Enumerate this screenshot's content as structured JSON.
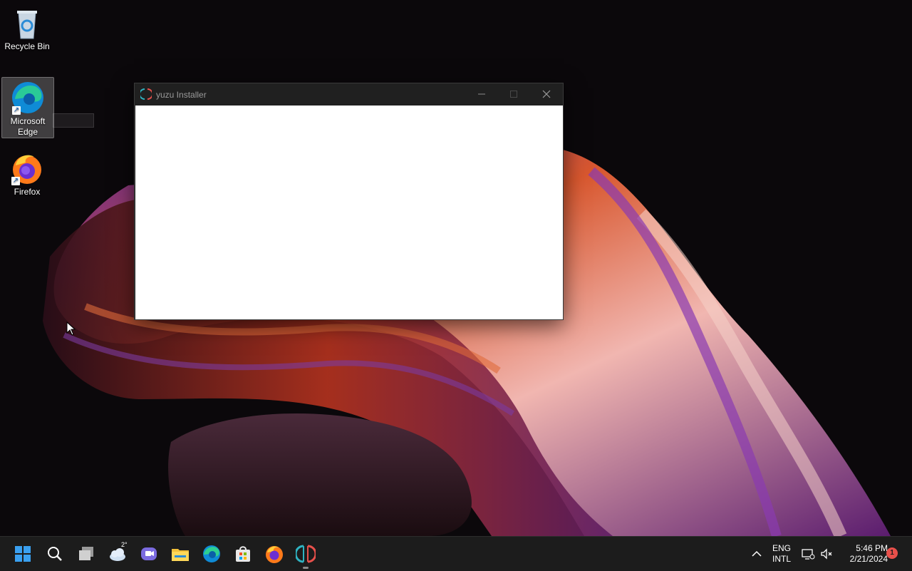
{
  "desktop": {
    "icons": [
      {
        "label": "Recycle Bin",
        "icon": "recycle-bin-icon"
      },
      {
        "label": "Microsoft Edge",
        "icon": "edge-icon"
      },
      {
        "label": "Firefox",
        "icon": "firefox-icon"
      }
    ]
  },
  "window": {
    "title": "yuzu Installer",
    "icon": "yuzu-icon",
    "buttons": [
      "minimize",
      "maximize",
      "close"
    ]
  },
  "taskbar": {
    "pinned": [
      "start",
      "search",
      "task-view",
      "weather",
      "teams-chat",
      "file-explorer",
      "edge",
      "microsoft-store",
      "firefox",
      "yuzu"
    ],
    "weather_temp": "2°",
    "language_line1": "ENG",
    "language_line2": "INTL",
    "time": "5:46 PM",
    "date": "2/21/2024",
    "notification_count": "1"
  },
  "colors": {
    "taskbar_bg": "#1c1c1c",
    "window_titlebar": "#202020",
    "window_content": "#ffffff",
    "notification_badge": "#e8504b"
  }
}
